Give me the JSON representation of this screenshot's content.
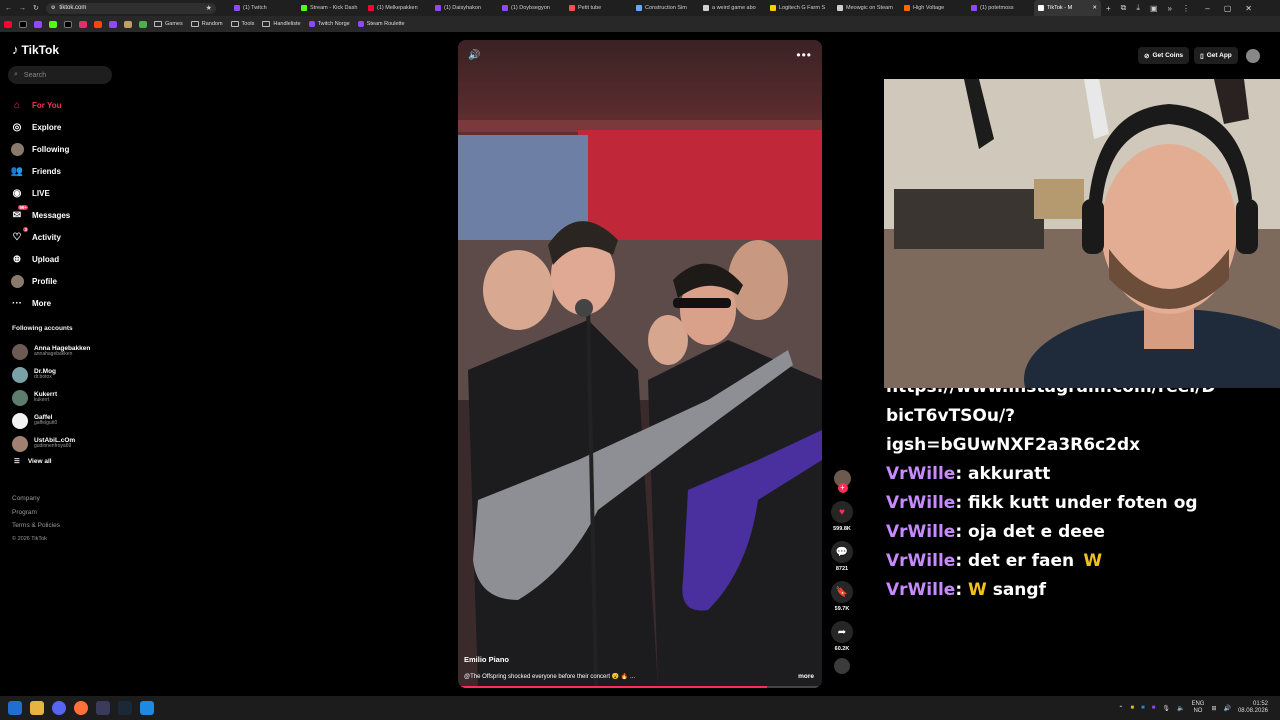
{
  "browser": {
    "url": "tiktok.com",
    "tabs": [
      {
        "label": "(1) Twitch",
        "color": "#9146ff"
      },
      {
        "label": "Stream - Kick Dash",
        "color": "#53fc18"
      },
      {
        "label": "(1) Melkepakken",
        "color": "#ff0033"
      },
      {
        "label": "(1) Daisyhakon",
        "color": "#9146ff"
      },
      {
        "label": "(1) Doybsegyon",
        "color": "#9146ff"
      },
      {
        "label": "Petit tube",
        "color": "#ff4d4d"
      },
      {
        "label": "Construction Sim",
        "color": "#66aaff"
      },
      {
        "label": "a weird game abo",
        "color": "#cfcfcf"
      },
      {
        "label": "Logitech G Farm S",
        "color": "#ffcc00"
      },
      {
        "label": "Meowgic on Steam",
        "color": "#cfcfcf"
      },
      {
        "label": "High Voltage",
        "color": "#ff6600"
      },
      {
        "label": "(1) potetmoss",
        "color": "#9146ff"
      },
      {
        "label": "TikTok - M",
        "color": "#ffffff"
      }
    ],
    "bookmarks": [
      {
        "label": "Games",
        "type": "folder"
      },
      {
        "label": "Random",
        "type": "folder"
      },
      {
        "label": "Tools",
        "type": "folder"
      },
      {
        "label": "Handleliste",
        "type": "folder"
      },
      {
        "label": "Twitch Norge",
        "type": "site"
      },
      {
        "label": "Steam Roulette",
        "type": "site"
      }
    ]
  },
  "tiktok": {
    "logo": "TikTok",
    "search_placeholder": "Search",
    "nav": [
      {
        "label": "For You",
        "icon": "home-icon",
        "active": true
      },
      {
        "label": "Explore",
        "icon": "compass-icon"
      },
      {
        "label": "Following",
        "icon": "avatar"
      },
      {
        "label": "Friends",
        "icon": "friends-icon"
      },
      {
        "label": "LIVE",
        "icon": "live-icon"
      },
      {
        "label": "Messages",
        "icon": "message-icon",
        "badge": "99+"
      },
      {
        "label": "Activity",
        "icon": "activity-icon",
        "badge": "3"
      },
      {
        "label": "Upload",
        "icon": "upload-icon"
      },
      {
        "label": "Profile",
        "icon": "profile-avatar"
      },
      {
        "label": "More",
        "icon": "more-icon"
      }
    ],
    "following_title": "Following accounts",
    "following": [
      {
        "name": "Anna Hagebakken",
        "handle": "annahagebakken",
        "color": "#6b5b52"
      },
      {
        "name": "Dr.Mog",
        "handle": "dr.botox",
        "color": "#7aa0a8"
      },
      {
        "name": "Kukerrt",
        "handle": "kukerrt",
        "color": "#5e7d6c"
      },
      {
        "name": "Gaffel",
        "handle": "gaffelgutt0",
        "color": "#f2f2f2"
      },
      {
        "name": "UstAbiL.cOm",
        "handle": "gudinnenfroya69",
        "color": "#a08070"
      }
    ],
    "view_all": "View all",
    "footer": [
      "Company",
      "Program",
      "Terms & Policies"
    ],
    "copyright": "© 2026 TikTok",
    "get_coins": "Get Coins",
    "get_app": "Get App",
    "video": {
      "author": "Emilio Piano",
      "caption": "@The Offspring shocked everyone before their concert 😮 🔥 ...",
      "more": "more",
      "progress": 0.85,
      "likes": "599.8K",
      "comments": "8721",
      "saves": "59.7K",
      "shares": "60.2K"
    }
  },
  "chat": {
    "partial_line": "https://www.instagram.com/reel/D",
    "lines_plain": [
      "bicT6vTSOu/?",
      "igsh=bGUwNXF2a3R6c2dx"
    ],
    "messages": [
      {
        "user": "VrWille",
        "text": "akkuratt"
      },
      {
        "user": "VrWille",
        "text": "fikk kutt under foten og"
      },
      {
        "user": "VrWille",
        "text": "oja det e deee"
      },
      {
        "user": "VrWille",
        "text": "det er faen  W"
      },
      {
        "user": "VrWille",
        "text": "W sangf"
      }
    ]
  },
  "taskbar": {
    "lang_top": "ENG",
    "lang_bottom": "NO",
    "time": "01:52",
    "date": "08.08.2026"
  }
}
